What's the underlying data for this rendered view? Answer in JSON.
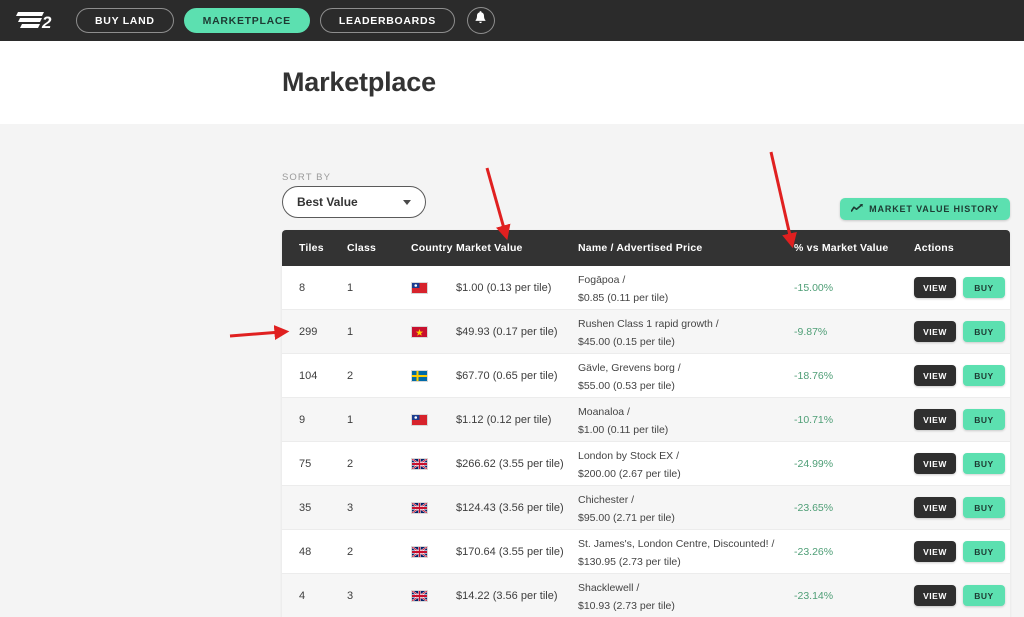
{
  "nav": {
    "logo_icon": "e2-logo-icon",
    "items": [
      {
        "label": "BUY LAND",
        "active": false
      },
      {
        "label": "MARKETPLACE",
        "active": true
      },
      {
        "label": "LEADERBOARDS",
        "active": false
      }
    ],
    "bell_icon": "bell-icon"
  },
  "header": {
    "title": "Marketplace"
  },
  "controls": {
    "sort_label": "SORT BY",
    "sort_value": "Best Value",
    "sort_caret_icon": "chevron-down-icon",
    "market_value_history_label": "MARKET VALUE HISTORY",
    "market_value_history_icon": "trending-chart-icon"
  },
  "table": {
    "columns": [
      "Tiles",
      "Class",
      "Country",
      "Market Value",
      "Name / Advertised Price",
      "% vs Market Value",
      "Actions"
    ],
    "action_labels": {
      "view": "VIEW",
      "buy": "BUY"
    },
    "rows": [
      {
        "tiles": "8",
        "class": "1",
        "country": "taiwan",
        "market_value": "$1.00 (0.13 per tile)",
        "name": "Fogāpoa /",
        "advertised_price": "$0.85 (0.11 per tile)",
        "pct": "-15.00%"
      },
      {
        "tiles": "299",
        "class": "1",
        "country": "vietnam",
        "market_value": "$49.93 (0.17 per tile)",
        "name": "Rushen Class 1 rapid growth /",
        "advertised_price": "$45.00 (0.15 per tile)",
        "pct": "-9.87%"
      },
      {
        "tiles": "104",
        "class": "2",
        "country": "sweden",
        "market_value": "$67.70 (0.65 per tile)",
        "name": "Gävle, Grevens borg /",
        "advertised_price": "$55.00 (0.53 per tile)",
        "pct": "-18.76%"
      },
      {
        "tiles": "9",
        "class": "1",
        "country": "taiwan",
        "market_value": "$1.12 (0.12 per tile)",
        "name": "Moanaloa /",
        "advertised_price": "$1.00 (0.11 per tile)",
        "pct": "-10.71%"
      },
      {
        "tiles": "75",
        "class": "2",
        "country": "uk",
        "market_value": "$266.62 (3.55 per tile)",
        "name": "London by Stock EX /",
        "advertised_price": "$200.00 (2.67 per tile)",
        "pct": "-24.99%"
      },
      {
        "tiles": "35",
        "class": "3",
        "country": "uk",
        "market_value": "$124.43 (3.56 per tile)",
        "name": "Chichester /",
        "advertised_price": "$95.00 (2.71 per tile)",
        "pct": "-23.65%"
      },
      {
        "tiles": "48",
        "class": "2",
        "country": "uk",
        "market_value": "$170.64 (3.55 per tile)",
        "name": "St. James's, London Centre, Discounted! /",
        "advertised_price": "$130.95 (2.73 per tile)",
        "pct": "-23.26%"
      },
      {
        "tiles": "4",
        "class": "3",
        "country": "uk",
        "market_value": "$14.22 (3.56 per tile)",
        "name": "Shacklewell /",
        "advertised_price": "$10.93 (2.73 per tile)",
        "pct": "-23.14%"
      }
    ]
  },
  "annotations": {
    "arrow_color": "#e02020",
    "arrows": [
      {
        "name": "arrow-to-market-value-column"
      },
      {
        "name": "arrow-to-pct-vs-market-value-column"
      },
      {
        "name": "arrow-to-tiles-row"
      }
    ]
  },
  "colors": {
    "accent_mint": "#5ce0b0",
    "nav_dark": "#2b2b2b",
    "header_dark": "#333333",
    "pct_green": "#4e9e76",
    "page_bg": "#f4f4f4"
  }
}
